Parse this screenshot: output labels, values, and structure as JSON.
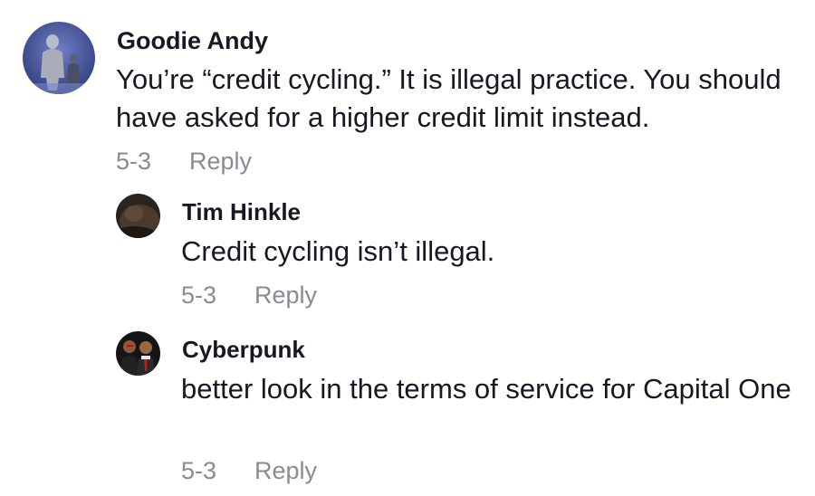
{
  "comments": [
    {
      "username": "Goodie Andy",
      "text": "You’re “credit cycling.” It is illegal practice. You should have asked for a higher credit limit instead.",
      "date": "5-3",
      "reply_label": "Reply",
      "avatar_icon": "statue-photo-avatar",
      "avatar_color": "#3b4a8c"
    },
    {
      "username": "Tim Hinkle",
      "text": "Credit cycling isn’t illegal.",
      "date": "5-3",
      "reply_label": "Reply",
      "avatar_icon": "dark-photo-avatar",
      "avatar_color": "#3a2e25"
    },
    {
      "username": "Cyberpunk",
      "text": "better look in the terms of service for Capital One",
      "date": "5-3",
      "reply_label": "Reply",
      "avatar_icon": "two-people-photo-avatar",
      "avatar_color": "#1a1a1a"
    }
  ],
  "colors": {
    "username": "#161823",
    "text": "#161823",
    "meta": "#8a8b91",
    "background": "#ffffff"
  }
}
